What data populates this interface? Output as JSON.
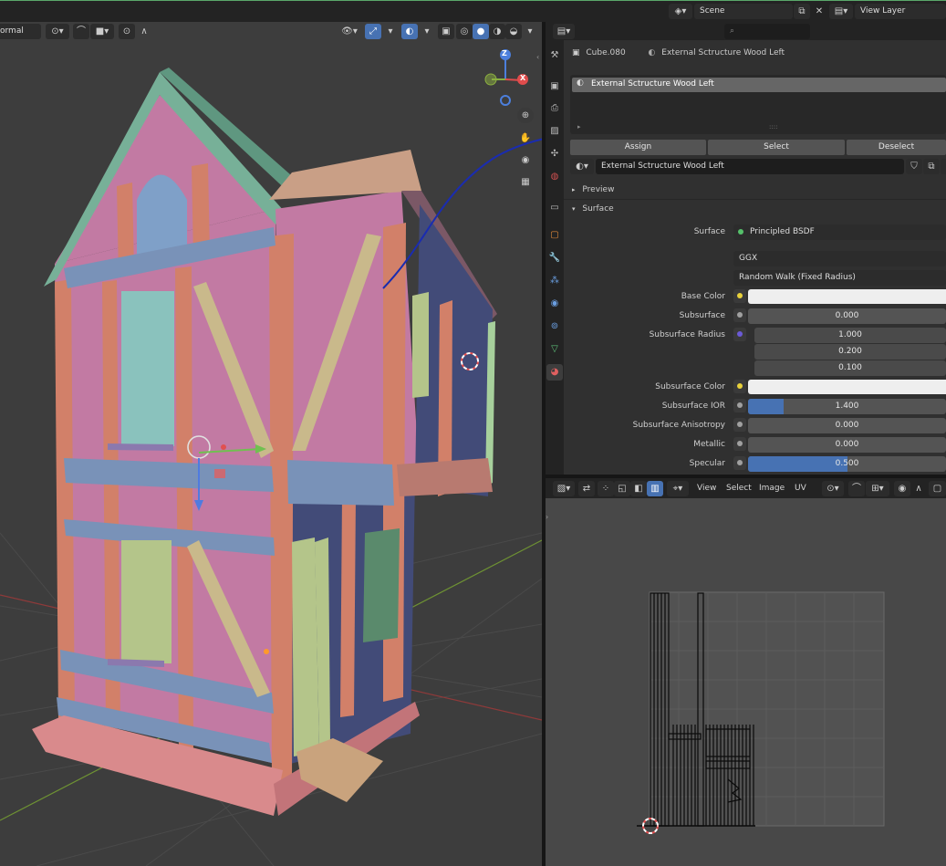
{
  "topbar": {
    "scene_label": "Scene",
    "view_layer_label": "View Layer"
  },
  "viewport": {
    "mode_label": "ormal",
    "gizmo_axes": [
      "Z",
      "X"
    ]
  },
  "properties": {
    "object_name": "Cube.080",
    "material_name": "External Sctructure Wood  Left",
    "slot_name": "External Sctructure Wood  Left",
    "assign_label": "Assign",
    "select_label": "Select",
    "deselect_label": "Deselect",
    "material_field": "External Sctructure Wood  Left",
    "preview_label": "Preview",
    "surface_panel_label": "Surface",
    "surface_label": "Surface",
    "surface_shader": "Principled BSDF",
    "distribution": "GGX",
    "subsurface_method": "Random Walk (Fixed Radius)",
    "rows": {
      "base_color": "Base Color",
      "subsurface": "Subsurface",
      "subsurface_value": "0.000",
      "subsurface_radius": "Subsurface Radius",
      "radius_values": [
        "1.000",
        "0.200",
        "0.100"
      ],
      "subsurface_color": "Subsurface Color",
      "subsurface_ior": "Subsurface IOR",
      "subsurface_ior_value": "1.400",
      "subsurface_ior_fill": 0.18,
      "subsurface_anisotropy": "Subsurface Anisotropy",
      "subsurface_anisotropy_value": "0.000",
      "metallic": "Metallic",
      "metallic_value": "0.000",
      "specular": "Specular",
      "specular_value": "0.500",
      "specular_fill": 0.5
    },
    "colors": {
      "accent": "#4772b3",
      "base_color_swatch": "#eeeeee",
      "subsurface_color_swatch": "#eeeeee"
    }
  },
  "uv_editor": {
    "menu": [
      "View",
      "Select",
      "Image",
      "UV"
    ]
  }
}
